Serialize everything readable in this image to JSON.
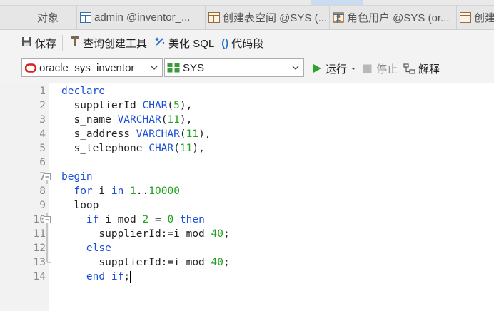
{
  "tabs": [
    {
      "label": "对象",
      "icon": "none"
    },
    {
      "label": "admin @inventor_...",
      "icon": "table-icon"
    },
    {
      "label": "创建表空间 @SYS (...",
      "icon": "table-icon"
    },
    {
      "label": "角色用户 @SYS (or...",
      "icon": "role-icon"
    },
    {
      "label": "创建",
      "icon": "table-icon"
    }
  ],
  "toolbar": {
    "save": "保存",
    "query_builder": "查询创建工具",
    "beautify": "美化 SQL",
    "snippet": "代码段"
  },
  "run_bar": {
    "connection": "oracle_sys_inventor_",
    "schema": "SYS",
    "run": "运行",
    "stop": "停止",
    "explain": "解释"
  },
  "editor": {
    "lines": [
      {
        "n": "1",
        "html": "<span class='kw'>declare</span>"
      },
      {
        "n": "2",
        "html": "  supplierId <span class='kw'>CHAR</span>(<span class='num'>5</span>),"
      },
      {
        "n": "3",
        "html": "  s_name <span class='kw'>VARCHAR</span>(<span class='num'>11</span>),"
      },
      {
        "n": "4",
        "html": "  s_address <span class='kw'>VARCHAR</span>(<span class='num'>11</span>),"
      },
      {
        "n": "5",
        "html": "  s_telephone <span class='kw'>CHAR</span>(<span class='num'>11</span>),"
      },
      {
        "n": "6",
        "html": ""
      },
      {
        "n": "7",
        "html": "<span class='kw'>begin</span>"
      },
      {
        "n": "8",
        "html": "  <span class='kw'>for</span> i <span class='kw'>in</span> <span class='num'>1</span>..<span class='num'>10000</span>"
      },
      {
        "n": "9",
        "html": "  loop"
      },
      {
        "n": "10",
        "html": "    <span class='kw'>if</span> i mod <span class='num'>2</span> = <span class='num'>0</span> <span class='kw'>then</span>"
      },
      {
        "n": "11",
        "html": "      supplierId:=i mod <span class='num'>40</span>;"
      },
      {
        "n": "12",
        "html": "    <span class='kw'>else</span>"
      },
      {
        "n": "13",
        "html": "      supplierId:=i mod <span class='num'>40</span>;"
      },
      {
        "n": "14",
        "html": "    <span class='kw'>end if</span>;<span class='caret'></span>"
      }
    ]
  }
}
